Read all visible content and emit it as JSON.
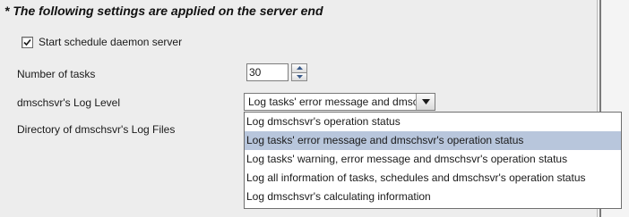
{
  "section_title": "* The following settings are applied on the server end",
  "start_daemon": {
    "label": "Start schedule daemon server",
    "checked": true
  },
  "number_of_tasks": {
    "label": "Number of tasks",
    "value": "30"
  },
  "log_level": {
    "label": "dmschsvr's Log Level",
    "selected_display": "Log tasks' error message and dmschsvr's opera..."
  },
  "log_directory": {
    "label": "Directory of dmschsvr's Log Files"
  },
  "log_level_options": [
    "Log dmschsvr's operation status",
    "Log tasks' error message and dmschsvr's operation status",
    "Log tasks' warning, error message and dmschsvr's operation status",
    "Log all information of tasks, schedules and dmschsvr's operation status",
    "Log dmschsvr's calculating information"
  ],
  "highlighted_option_index": 1,
  "colors": {
    "panel_bg": "#ededed",
    "highlight": "#b8c6dc",
    "text": "#1a1a1a"
  },
  "icons": {
    "checkbox": "checkmark-icon",
    "spinner_up": "triangle-up-icon",
    "spinner_down": "triangle-down-icon",
    "combo_arrow": "chevron-down-icon"
  }
}
